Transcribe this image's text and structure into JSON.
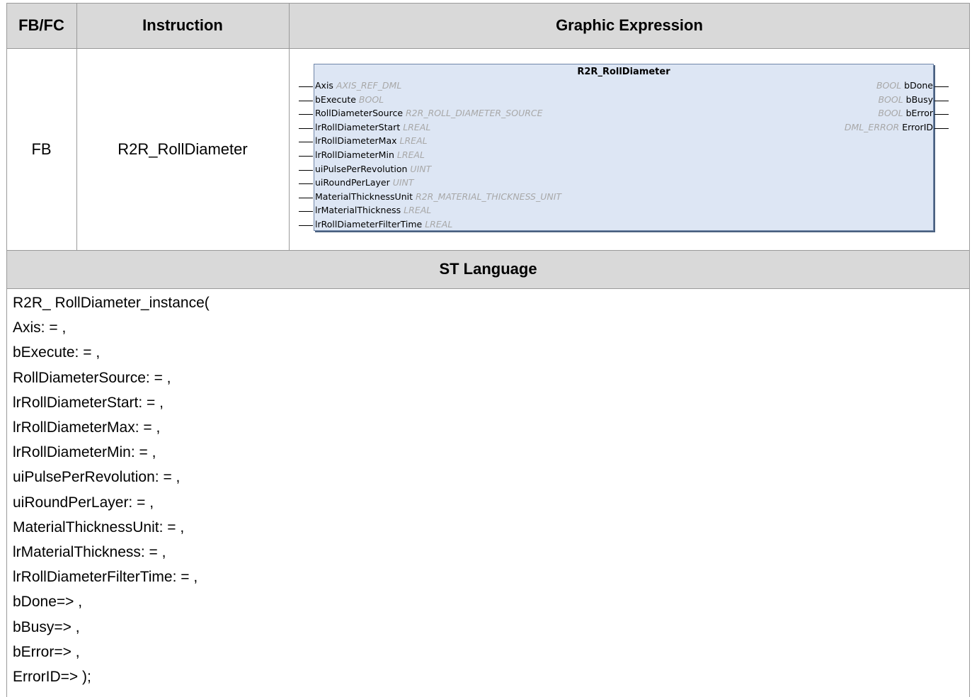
{
  "headers": {
    "fbfc": "FB/FC",
    "instruction": "Instruction",
    "graphic": "Graphic Expression",
    "st_language": "ST Language"
  },
  "row": {
    "type": "FB",
    "instruction": "R2R_RollDiameter"
  },
  "block": {
    "title": "R2R_RollDiameter",
    "inputs": [
      {
        "name": "Axis",
        "type": "AXIS_REF_DML"
      },
      {
        "name": "bExecute",
        "type": "BOOL"
      },
      {
        "name": "RollDiameterSource",
        "type": "R2R_ROLL_DIAMETER_SOURCE"
      },
      {
        "name": "lrRollDiameterStart",
        "type": "LREAL"
      },
      {
        "name": "lrRollDiameterMax",
        "type": "LREAL"
      },
      {
        "name": "lrRollDiameterMin",
        "type": "LREAL"
      },
      {
        "name": "uiPulsePerRevolution",
        "type": "UINT"
      },
      {
        "name": "uiRoundPerLayer",
        "type": "UINT"
      },
      {
        "name": "MaterialThicknessUnit",
        "type": "R2R_MATERIAL_THICKNESS_UNIT"
      },
      {
        "name": "lrMaterialThickness",
        "type": "LREAL"
      },
      {
        "name": "lrRollDiameterFilterTime",
        "type": "LREAL"
      }
    ],
    "outputs": [
      {
        "name": "bDone",
        "type": "BOOL"
      },
      {
        "name": "bBusy",
        "type": "BOOL"
      },
      {
        "name": "bError",
        "type": "BOOL"
      },
      {
        "name": "ErrorID",
        "type": "DML_ERROR"
      }
    ]
  },
  "st_code": [
    "R2R_ RollDiameter_instance(",
    "Axis: = ,",
    "bExecute: = ,",
    "RollDiameterSource: = ,",
    "lrRollDiameterStart: = ,",
    "lrRollDiameterMax: = ,",
    "lrRollDiameterMin: = ,",
    "uiPulsePerRevolution: = ,",
    "uiRoundPerLayer: = ,",
    "MaterialThicknessUnit: = ,",
    "lrMaterialThickness: = ,",
    "lrRollDiameterFilterTime: = ,",
    "bDone=> ,",
    "bBusy=> ,",
    "bError=> ,",
    "ErrorID=> );"
  ]
}
